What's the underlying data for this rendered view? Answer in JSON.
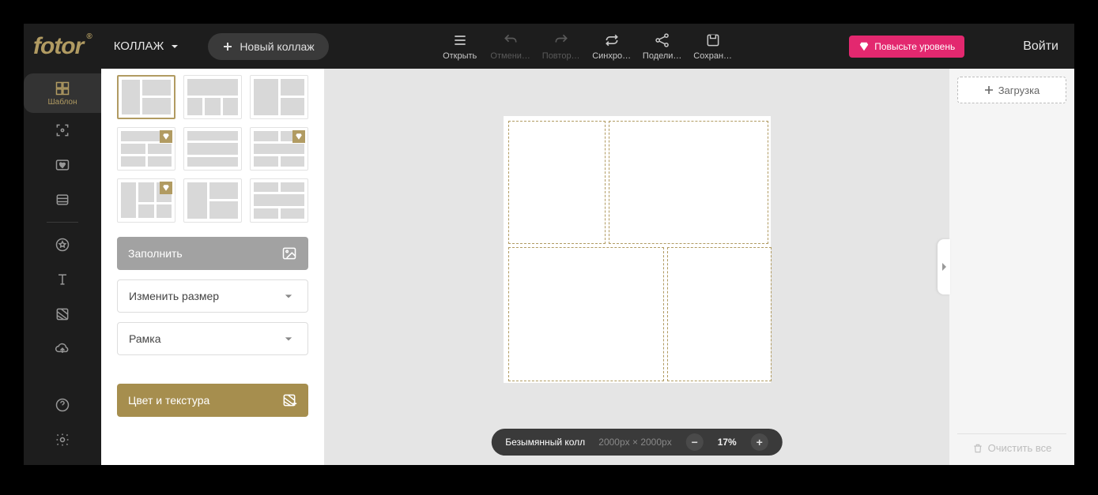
{
  "header": {
    "logo": "fotor",
    "mode": "КОЛЛАЖ",
    "new_btn": "Новый коллаж",
    "toolbar": {
      "open": "Открыть",
      "undo": "Отмени…",
      "redo": "Повтор…",
      "sync": "Синхро…",
      "share": "Подели…",
      "save": "Сохран…"
    },
    "upgrade": "Повысьте уровень",
    "login": "Войти"
  },
  "sidebar": {
    "template_label": "Шаблон"
  },
  "panel": {
    "fill": "Заполнить",
    "resize": "Изменить размер",
    "frame": "Рамка",
    "color_texture": "Цвет и текстура"
  },
  "canvas": {
    "doc_name": "Безымянный колла",
    "dimensions": "2000px × 2000px",
    "zoom": "17%"
  },
  "right": {
    "upload": "Загрузка",
    "clear": "Очистить все"
  }
}
